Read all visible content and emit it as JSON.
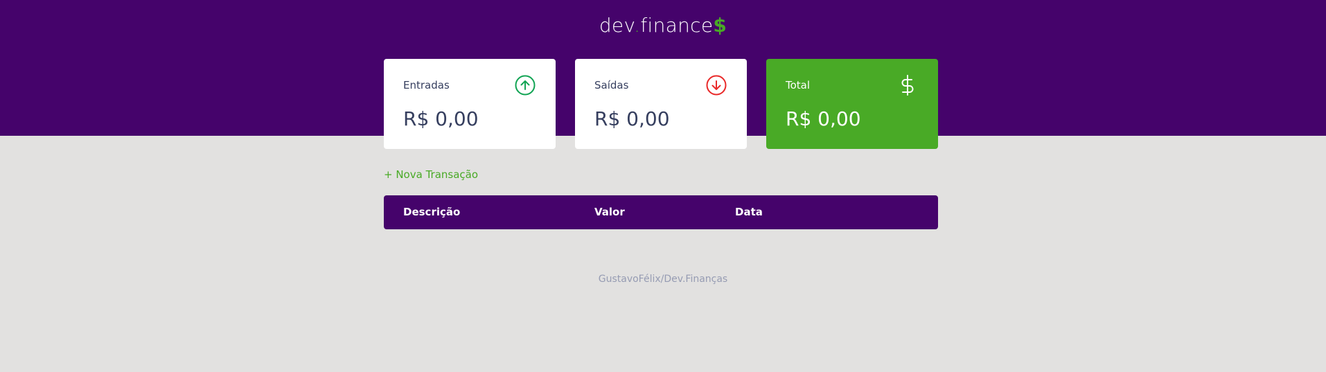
{
  "header": {
    "logo_main": "dev",
    "logo_dot": ".",
    "logo_rest": "finance",
    "logo_symbol": "$"
  },
  "cards": {
    "income": {
      "title": "Entradas",
      "value": "R$ 0,00",
      "icon": "arrow-up-circle-icon"
    },
    "expense": {
      "title": "Saídas",
      "value": "R$ 0,00",
      "icon": "arrow-down-circle-icon"
    },
    "total": {
      "title": "Total",
      "value": "R$ 0,00",
      "icon": "dollar-sign-icon"
    }
  },
  "actions": {
    "new_transaction": "+ Nova Transação"
  },
  "table": {
    "columns": [
      "Descrição",
      "Valor",
      "Data"
    ]
  },
  "footer": {
    "text": "GustavoFélix/Dev.Finanças"
  },
  "colors": {
    "brand_purple": "#45036b",
    "accent_green": "#49aa26",
    "income_green": "#12a454",
    "expense_red": "#e92929",
    "background": "#e2e1e0"
  }
}
